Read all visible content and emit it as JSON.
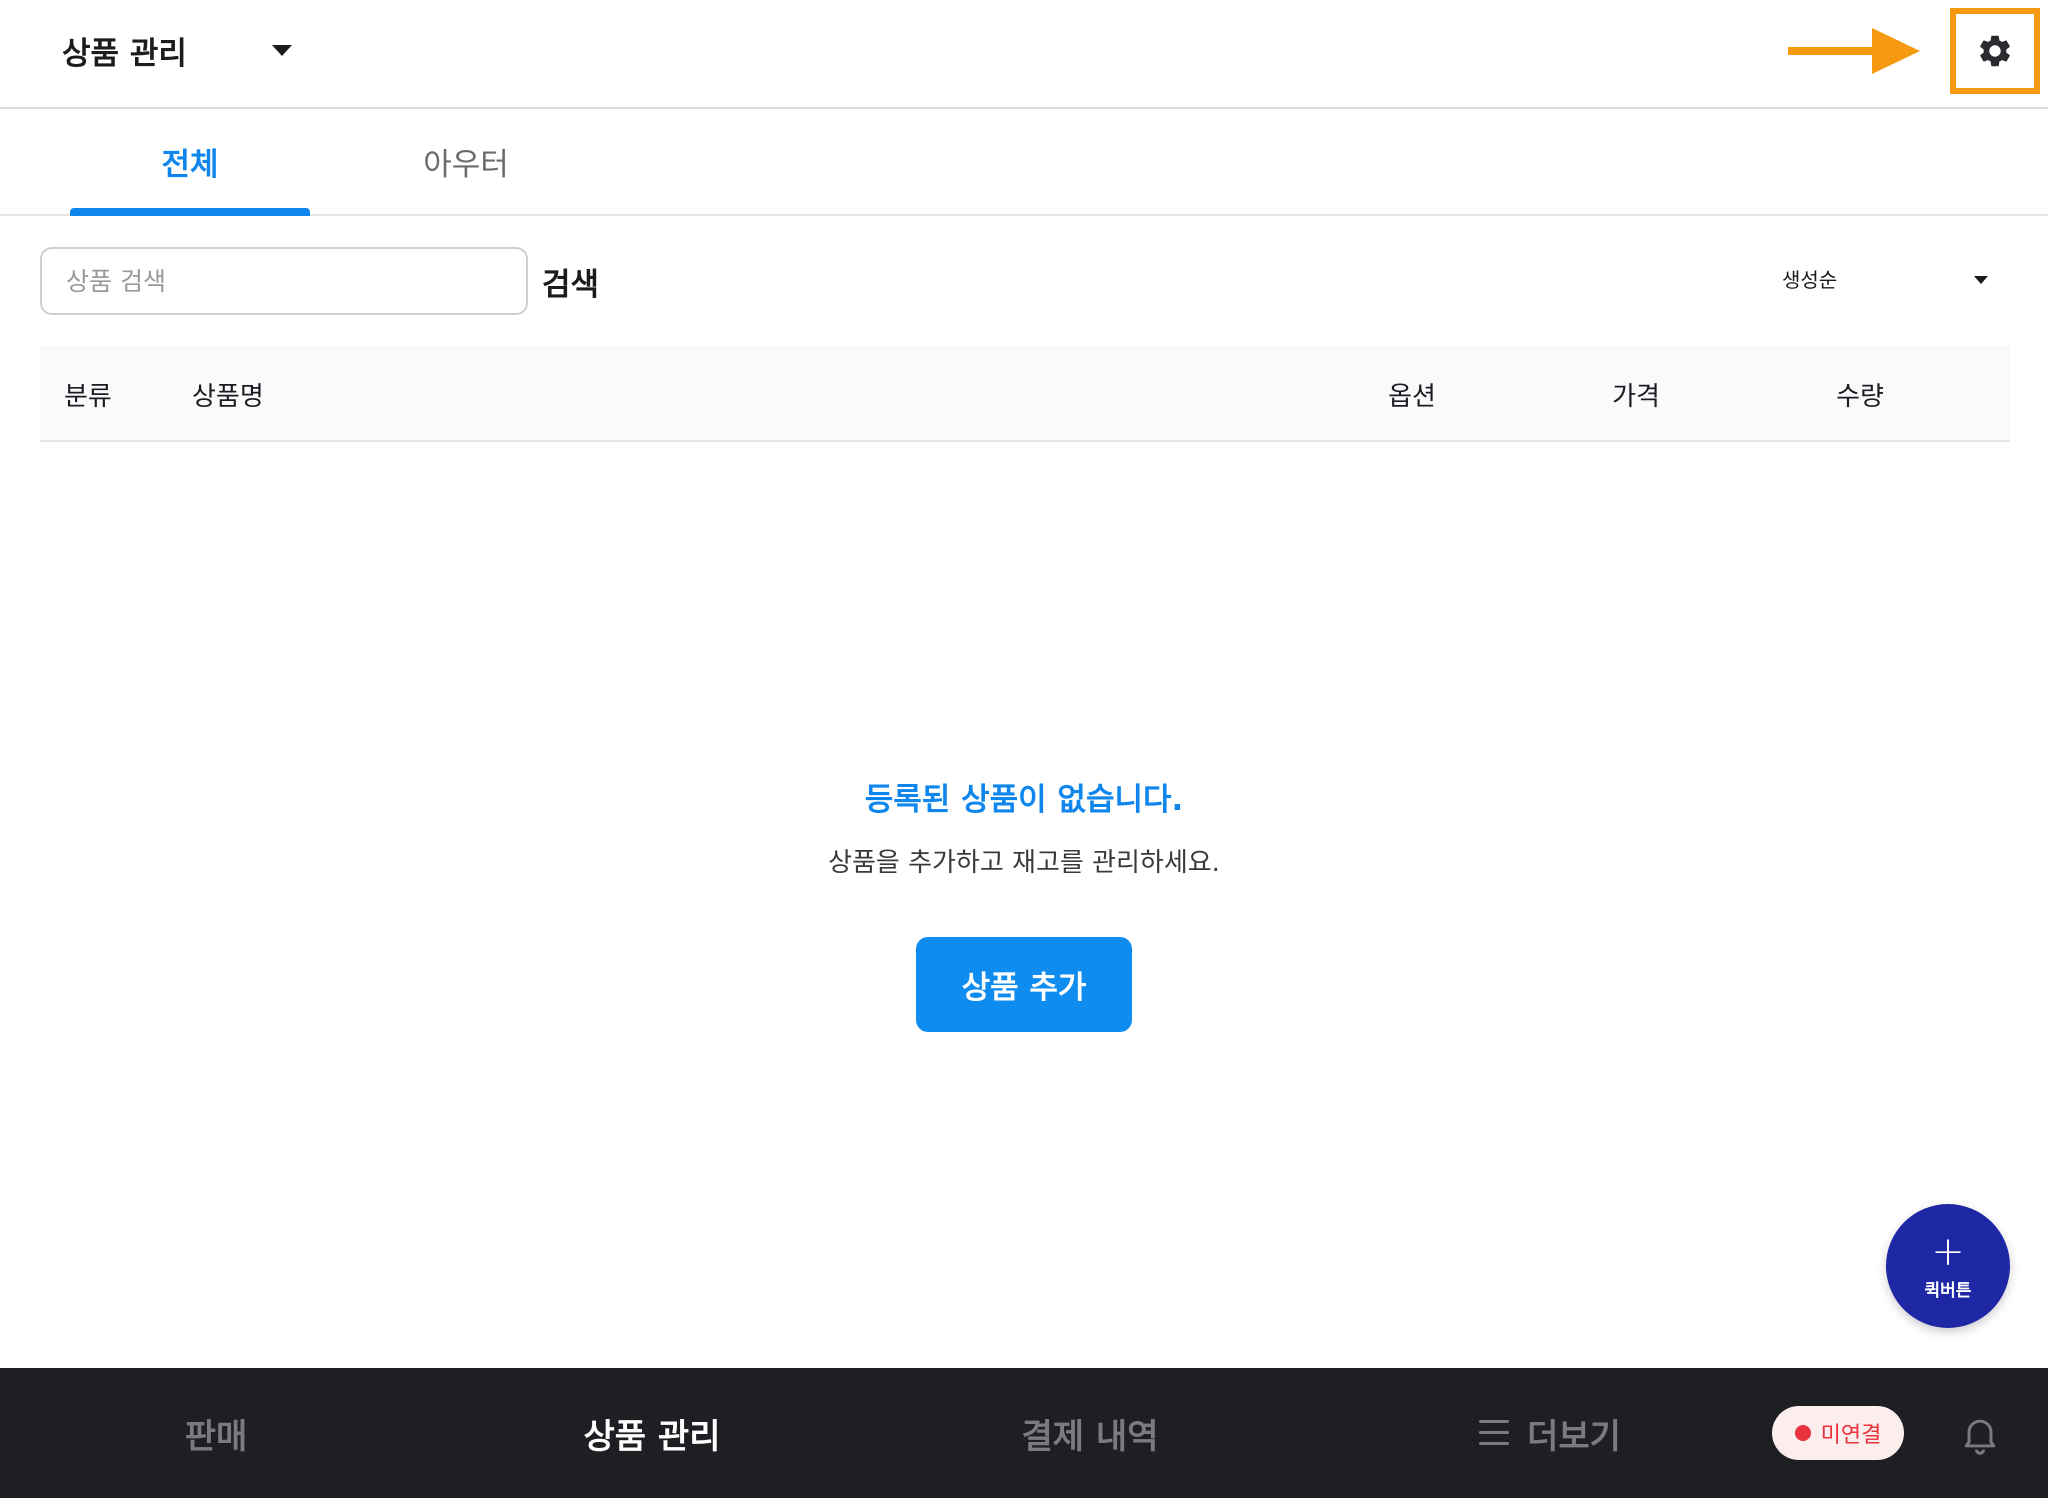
{
  "header": {
    "title": "상품 관리",
    "settings_icon": "gear-icon",
    "annotation_color": "#f59a10"
  },
  "tabs": [
    {
      "label": "전체",
      "active": true
    },
    {
      "label": "아우터",
      "active": false
    }
  ],
  "search": {
    "placeholder": "상품 검색",
    "value": "",
    "button_label": "검색"
  },
  "sort": {
    "selected": "생성순"
  },
  "table": {
    "columns": [
      "분류",
      "상품명",
      "옵션",
      "가격",
      "수량"
    ]
  },
  "empty_state": {
    "title": "등록된 상품이 없습니다.",
    "description": "상품을 추가하고 재고를 관리하세요.",
    "button_label": "상품 추가"
  },
  "fab": {
    "label": "퀵버튼",
    "icon": "plus-icon"
  },
  "bottom_nav": {
    "items": [
      {
        "label": "판매",
        "active": false
      },
      {
        "label": "상품 관리",
        "active": true
      },
      {
        "label": "결제 내역",
        "active": false
      },
      {
        "label": "더보기",
        "active": false
      }
    ],
    "connection_status": "미연결",
    "bell_icon": "bell-icon"
  },
  "colors": {
    "accent": "#0f86ec",
    "nav_bg": "#1e1f23",
    "fab_bg": "#1e28a5",
    "status_red": "#e8323c"
  }
}
